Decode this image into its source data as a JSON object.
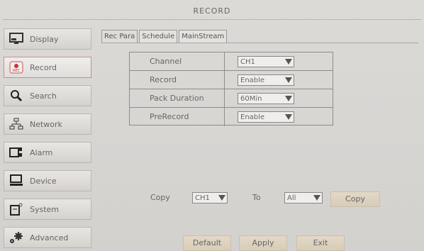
{
  "header": {
    "title": "RECORD"
  },
  "sidebar": {
    "items": [
      {
        "label": "Display",
        "icon": "monitor-icon"
      },
      {
        "label": "Record",
        "icon": "rec-icon",
        "active": true
      },
      {
        "label": "Search",
        "icon": "search-icon"
      },
      {
        "label": "Network",
        "icon": "network-icon"
      },
      {
        "label": "Alarm",
        "icon": "alarm-icon"
      },
      {
        "label": "Device",
        "icon": "device-icon"
      },
      {
        "label": "System",
        "icon": "system-icon"
      },
      {
        "label": "Advanced",
        "icon": "gears-icon"
      }
    ]
  },
  "tabs": [
    {
      "label": "Rec Para",
      "active": true
    },
    {
      "label": "Schedule"
    },
    {
      "label": "MainStream"
    }
  ],
  "params": [
    {
      "label": "Channel",
      "value": "CH1"
    },
    {
      "label": "Record",
      "value": "Enable"
    },
    {
      "label": "Pack Duration",
      "value": "60Min"
    },
    {
      "label": "PreRecord",
      "value": "Enable"
    }
  ],
  "copy": {
    "copy_label": "Copy",
    "from_value": "CH1",
    "to_label": "To",
    "to_value": "All",
    "button_label": "Copy"
  },
  "footer": {
    "default_label": "Default",
    "apply_label": "Apply",
    "exit_label": "Exit"
  },
  "colors": {
    "active_border": "#d18a8a",
    "button_bg": "#ddd3c0"
  }
}
